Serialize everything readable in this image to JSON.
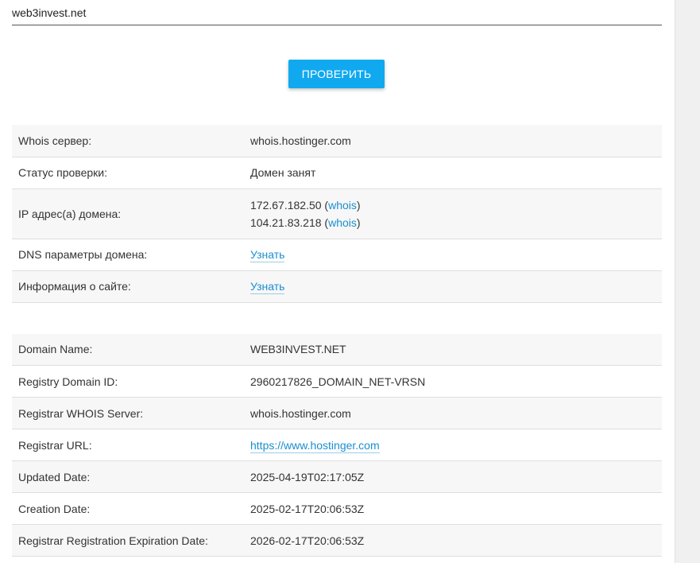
{
  "form": {
    "domain_value": "web3invest.net",
    "check_button_label": "ПРОВЕРИТЬ"
  },
  "summary": {
    "rows": [
      {
        "label": "Whois сервер:",
        "value": "whois.hostinger.com"
      },
      {
        "label": "Статус проверки:",
        "value": "Домен занят"
      },
      {
        "label": "IP адрес(а) домена:",
        "ips": [
          {
            "ip": "172.67.182.50",
            "open": " (",
            "link": "whois",
            "close": ")"
          },
          {
            "ip": "104.21.83.218",
            "open": " (",
            "link": "whois",
            "close": ")"
          }
        ]
      },
      {
        "label": "DNS параметры домена:",
        "link": "Узнать"
      },
      {
        "label": "Информация о сайте:",
        "link": "Узнать"
      }
    ]
  },
  "whois": {
    "rows": [
      {
        "label": "Domain Name:",
        "value": "WEB3INVEST.NET"
      },
      {
        "label": "Registry Domain ID:",
        "value": "2960217826_DOMAIN_NET-VRSN"
      },
      {
        "label": "Registrar WHOIS Server:",
        "value": "whois.hostinger.com"
      },
      {
        "label": "Registrar URL:",
        "link": "https://www.hostinger.com"
      },
      {
        "label": "Updated Date:",
        "value": "2025-04-19T02:17:05Z"
      },
      {
        "label": "Creation Date:",
        "value": "2025-02-17T20:06:53Z"
      },
      {
        "label": "Registrar Registration Expiration Date:",
        "value": "2026-02-17T20:06:53Z"
      }
    ]
  }
}
